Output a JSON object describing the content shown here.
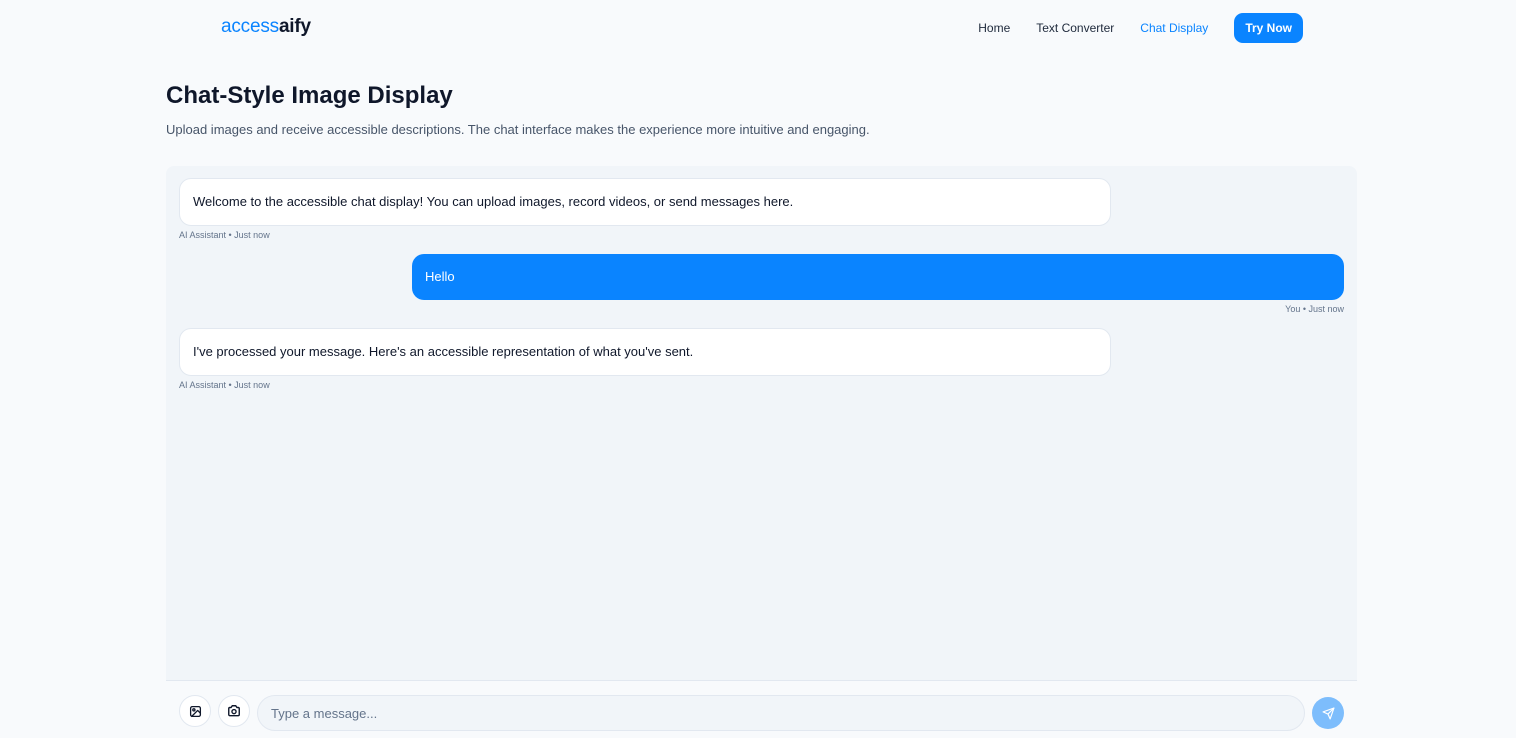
{
  "brand": {
    "part1": "access",
    "part2": "aify"
  },
  "nav": {
    "links": [
      {
        "label": "Home",
        "active": false
      },
      {
        "label": "Text Converter",
        "active": false
      },
      {
        "label": "Chat Display",
        "active": true
      }
    ],
    "cta_label": "Try Now"
  },
  "header": {
    "title": "Chat-Style Image Display",
    "subtitle": "Upload images and receive accessible descriptions. The chat interface makes the experience more intuitive and engaging."
  },
  "messages": [
    {
      "sender": "assistant",
      "text": "Welcome to the accessible chat display! You can upload images, record videos, or send messages here.",
      "meta": "AI Assistant • Just now"
    },
    {
      "sender": "user",
      "text": "Hello",
      "meta": "You • Just now"
    },
    {
      "sender": "assistant",
      "text": "I've processed your message. Here's an accessible representation of what you've sent.",
      "meta": "AI Assistant • Just now"
    }
  ],
  "composer": {
    "placeholder": "Type a message...",
    "value": "",
    "icons": [
      "image-upload-icon",
      "camera-icon",
      "send-icon"
    ]
  },
  "colors": {
    "accent": "#0a84ff",
    "send_button_disabled": "#7dbdfc",
    "background": "#f8fafc",
    "chat_background": "#f1f5f9"
  }
}
